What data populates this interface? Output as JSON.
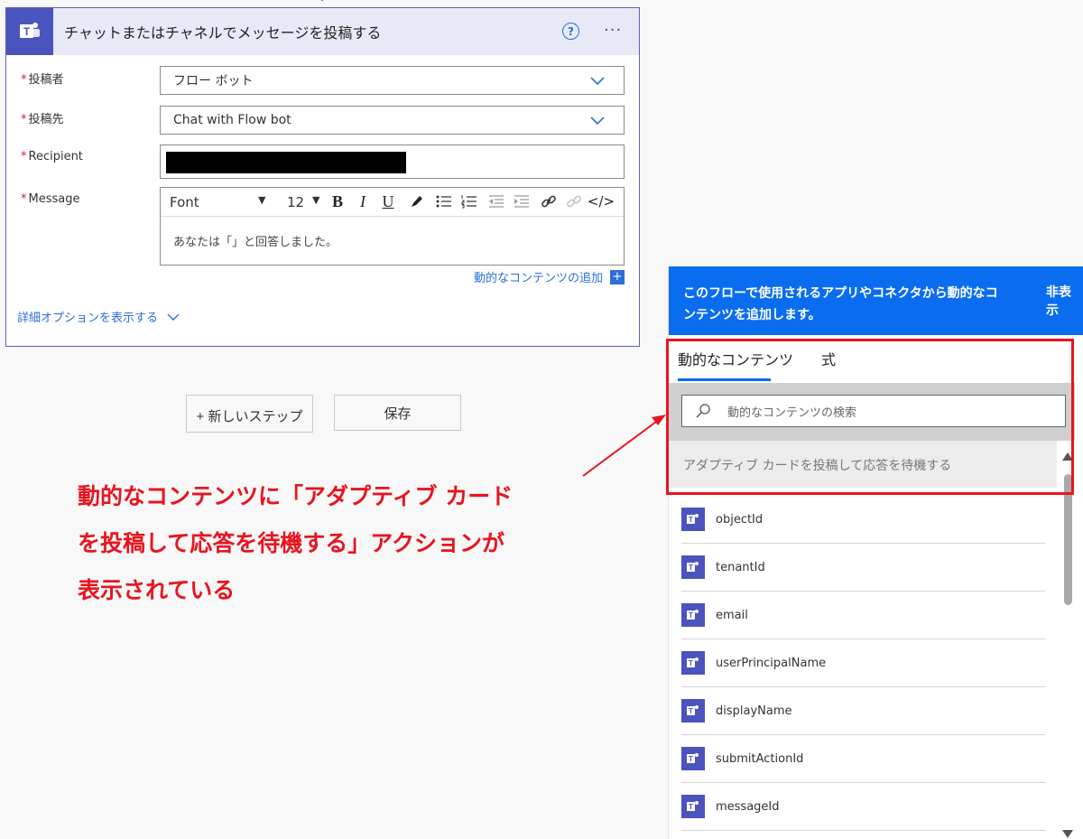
{
  "card": {
    "title": "チャットまたはチャネルでメッセージを投稿する",
    "help_glyph": "?",
    "more_glyph": "···",
    "fields": {
      "poster_label": "投稿者",
      "poster_value": "フロー ボット",
      "post_in_label": "投稿先",
      "post_in_value": "Chat with Flow bot",
      "recipient_label": "Recipient",
      "message_label": "Message"
    },
    "editor": {
      "font": "Font",
      "size": "12",
      "content": "あなたは「」と回答しました。"
    },
    "add_dynamic_label": "動的なコンテンツの追加",
    "advanced_label": "詳細オプションを表示する"
  },
  "buttons": {
    "new_step": "+ 新しいステップ",
    "save": "保存"
  },
  "annotation": {
    "line1": "動的なコンテンツに「アダプティブ カード",
    "line2": "を投稿して応答を待機する」アクションが",
    "line3": "表示されている",
    "color": "#e8141e"
  },
  "panel": {
    "header_text": "このフローで使用されるアプリやコネクタから動的なコンテンツを追加します。",
    "hide_label": "非表示",
    "tab_dynamic": "動的なコンテンツ",
    "tab_expression": "式",
    "search_placeholder": "動的なコンテンツの検索",
    "section_title": "アダプティブ カードを投稿して応答を待機する",
    "items": [
      "objectId",
      "tenantId",
      "email",
      "userPrincipalName",
      "displayName",
      "submitActionId",
      "messageId"
    ],
    "accent": "#0a6df0",
    "teams_color": "#4b53bc"
  }
}
